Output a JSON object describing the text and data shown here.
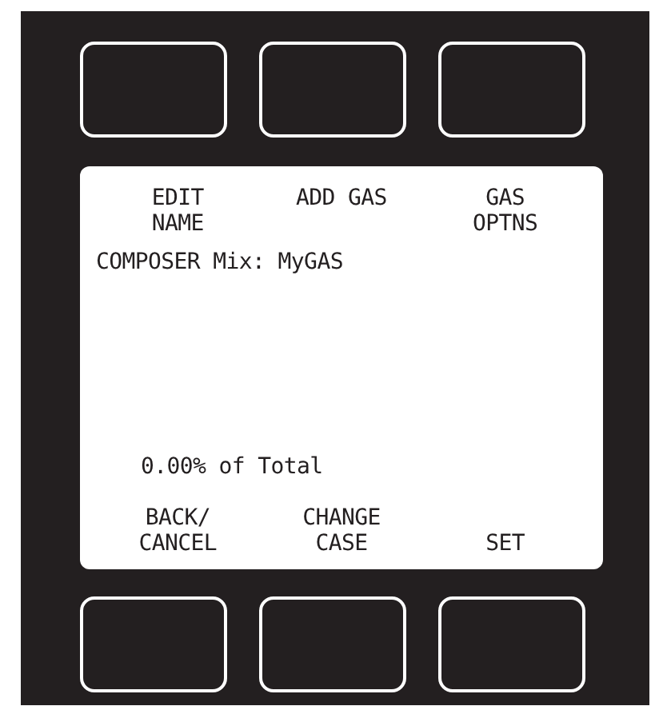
{
  "display": {
    "top_labels": [
      "EDIT\nNAME",
      "ADD GAS",
      "GAS\nOPTNS"
    ],
    "title": "COMPOSER Mix: MyGAS",
    "total": "0.00% of Total",
    "bottom_labels": [
      "BACK/\nCANCEL",
      "CHANGE\nCASE",
      "SET"
    ]
  }
}
